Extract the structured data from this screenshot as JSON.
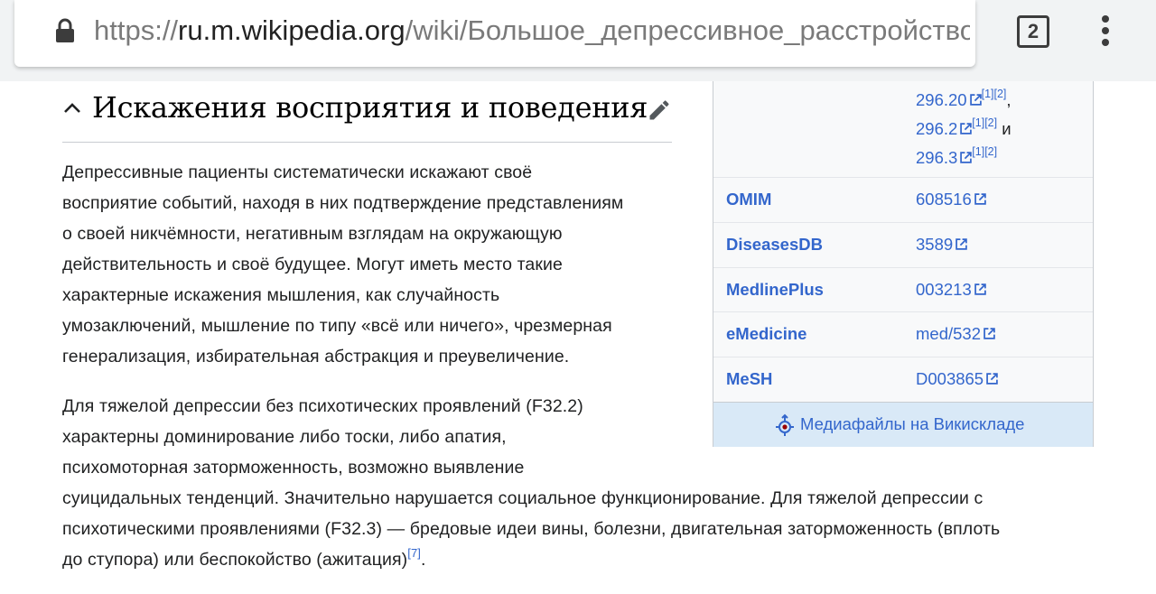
{
  "browser": {
    "url_scheme": "https://",
    "url_host": "ru.m.wikipedia.org",
    "url_path": "/wiki/Большое_депрессивное_расстройство",
    "tab_count": "2"
  },
  "section": {
    "title": "Искажения восприятия и поведения"
  },
  "paragraph1": {
    "lines": [
      "Депрессивные пациенты систематически искажают своё",
      "восприятие событий, находя в них подтверждение представлениям",
      "о своей никчёмности, негативным взглядам на окружающую",
      "действительность и своё будущее. Могут иметь место такие",
      "характерные искажения мышления, как случайность",
      "умозаключений, мышление по типу «всё или ничего», чрезмерная",
      "генерализация, избирательная абстракция и преувеличение."
    ]
  },
  "paragraph2": {
    "lines": [
      "Для тяжелой депрессии без психотических проявлений (F32.2)",
      "характерны доминирование либо тоски, либо апатия,",
      "психомоторная заторможенность, возможно выявление",
      "суицидальных тенденций. Значительно нарушается социальное функционирование. Для тяжелой депрессии с",
      "психотическими проявлениями (F32.3) — бредовые идеи вины, болезни, двигательная заторможенность (вплоть",
      "до ступора) или беспокойство (ажитация)"
    ],
    "ref": "[7]",
    "end": "."
  },
  "infobox": {
    "icd_codes": [
      {
        "code": "296.20",
        "refs": "[1][2]",
        "suffix": ","
      },
      {
        "code": "296.2",
        "refs": "[1][2]",
        "suffix": "и"
      },
      {
        "code": "296.3",
        "refs": "[1][2]",
        "suffix": ""
      }
    ],
    "rows": [
      {
        "key": "OMIM",
        "value": "608516"
      },
      {
        "key": "DiseasesDB",
        "value": "3589"
      },
      {
        "key": "MedlinePlus",
        "value": "003213"
      },
      {
        "key": "eMedicine",
        "value": "med/532"
      },
      {
        "key": "MeSH",
        "value": "D003865"
      }
    ],
    "commons_label": "Медиафайлы на Викискладе"
  },
  "colors": {
    "link": "#3366cc",
    "text": "#202122",
    "infobox_bg": "#f8f9fa",
    "commons_bg": "#d9e9f7"
  },
  "icons": [
    "lock-icon",
    "tab-switcher",
    "overflow-menu-icon",
    "chevron-up-icon",
    "pencil-edit-icon",
    "external-link-icon",
    "wikimedia-commons-icon"
  ]
}
